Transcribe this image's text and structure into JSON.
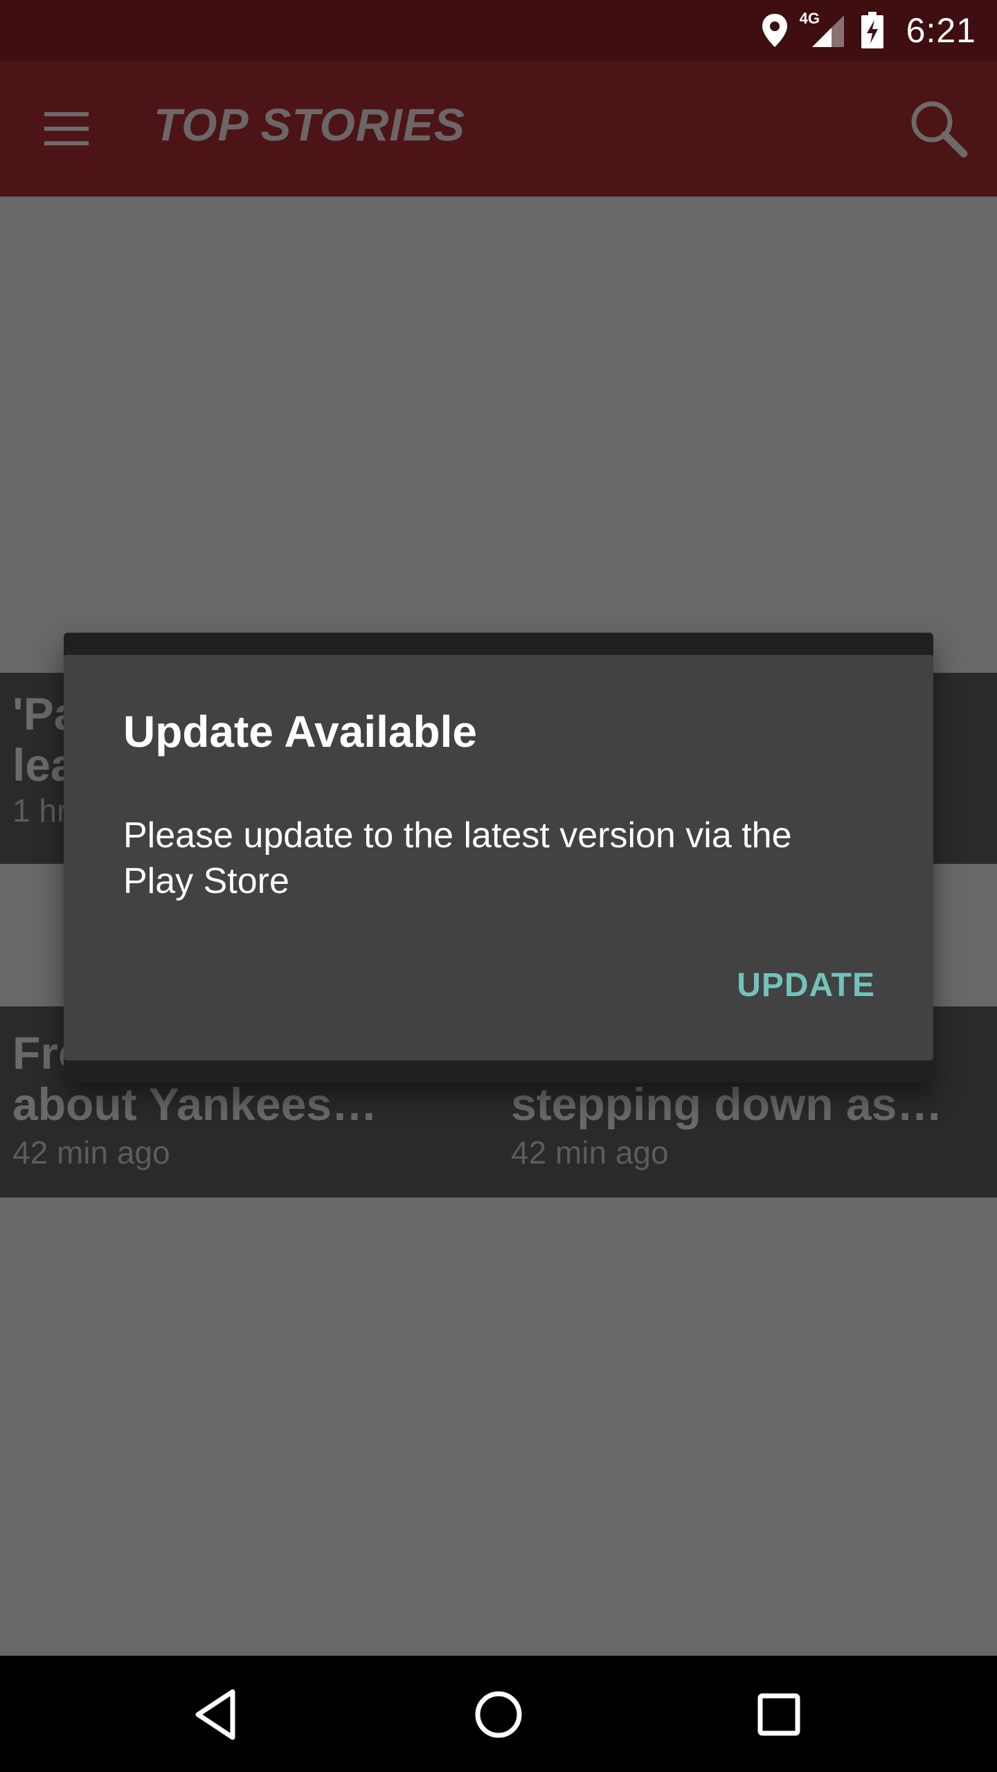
{
  "status_bar": {
    "time": "6:21",
    "network_label": "4G",
    "icons": [
      "location-icon",
      "signal-4g-icon",
      "battery-charging-icon"
    ]
  },
  "app_bar": {
    "title": "TOP STORIES",
    "menu_icon": "hamburger-menu-icon",
    "search_icon": "search-icon"
  },
  "stories": {
    "row1_left": {
      "line1": "'Pa",
      "line2": "lea",
      "time": "1 hr"
    },
    "row2_left": {
      "line1": "Fro",
      "line2": "about Yankees…",
      "time": "42 min ago"
    },
    "row2_right": {
      "line1": "",
      "line2": "stepping down as…",
      "time": "42 min ago"
    }
  },
  "dialog": {
    "title": "Update Available",
    "message": "Please update to the latest version via the Play Store",
    "button_label": "UPDATE"
  },
  "nav_bar": {
    "icons": [
      "back-icon",
      "home-icon",
      "recent-apps-icon"
    ]
  },
  "colors": {
    "status_bar": "#3e0e10",
    "app_bar": "#4c1416",
    "dialog_bg": "#424242",
    "accent": "#73c2bb",
    "scrim_bg": "#686868"
  }
}
